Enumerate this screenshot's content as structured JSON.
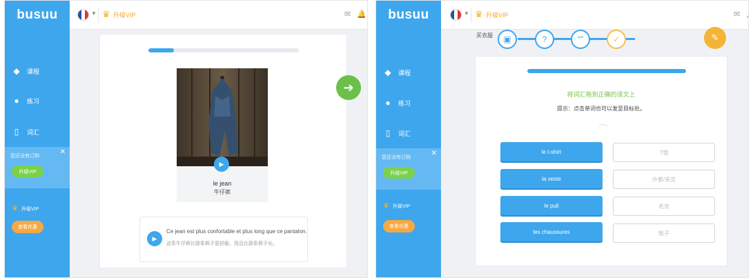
{
  "app": {
    "logo": "busuu",
    "upgrade_label": "升级VIP"
  },
  "sidebar": {
    "items": [
      {
        "label": "课程",
        "icon": "graduation-cap-icon"
      },
      {
        "label": "练习",
        "icon": "chat-bubble-icon"
      },
      {
        "label": "词汇",
        "icon": "phone-icon"
      }
    ],
    "promo_text": "您还没有订购",
    "promo_button": "升级VIP",
    "vip_label": "升级VIP",
    "vip_button": "查看优惠"
  },
  "left_lesson": {
    "progress": 0.17,
    "word_fr": "le jean",
    "word_zh": "牛仔裤",
    "sentence_fr": "Ce jean est plus confortable et plus long que ce pantalon.",
    "sentence_zh": "这条牛仔裤比那条裤子更舒服，而且比那条裤子长。"
  },
  "right_lesson": {
    "lesson_label": "买衣服",
    "steps": [
      {
        "icon": "flashcard-icon",
        "glyph": "▣"
      },
      {
        "icon": "question-icon",
        "glyph": "?"
      },
      {
        "icon": "dialogue-icon",
        "glyph": "“”"
      },
      {
        "icon": "check-icon",
        "glyph": "✓"
      }
    ],
    "lock_glyph": "✎",
    "progress": 1,
    "instruction": "将词汇拖到正确的译文上",
    "hint": "提示：点击单词也可以发至目标处。",
    "word_tiles": [
      "le t-shirt",
      "la veste",
      "le pull",
      "les chaussures"
    ],
    "answer_slots": [
      "T恤",
      "外套/夹克",
      "毛衣",
      "鞋子"
    ]
  },
  "colors": {
    "brand_blue": "#3ea6ed",
    "go_green": "#6cc04a",
    "vip_orange": "#f7a843"
  }
}
